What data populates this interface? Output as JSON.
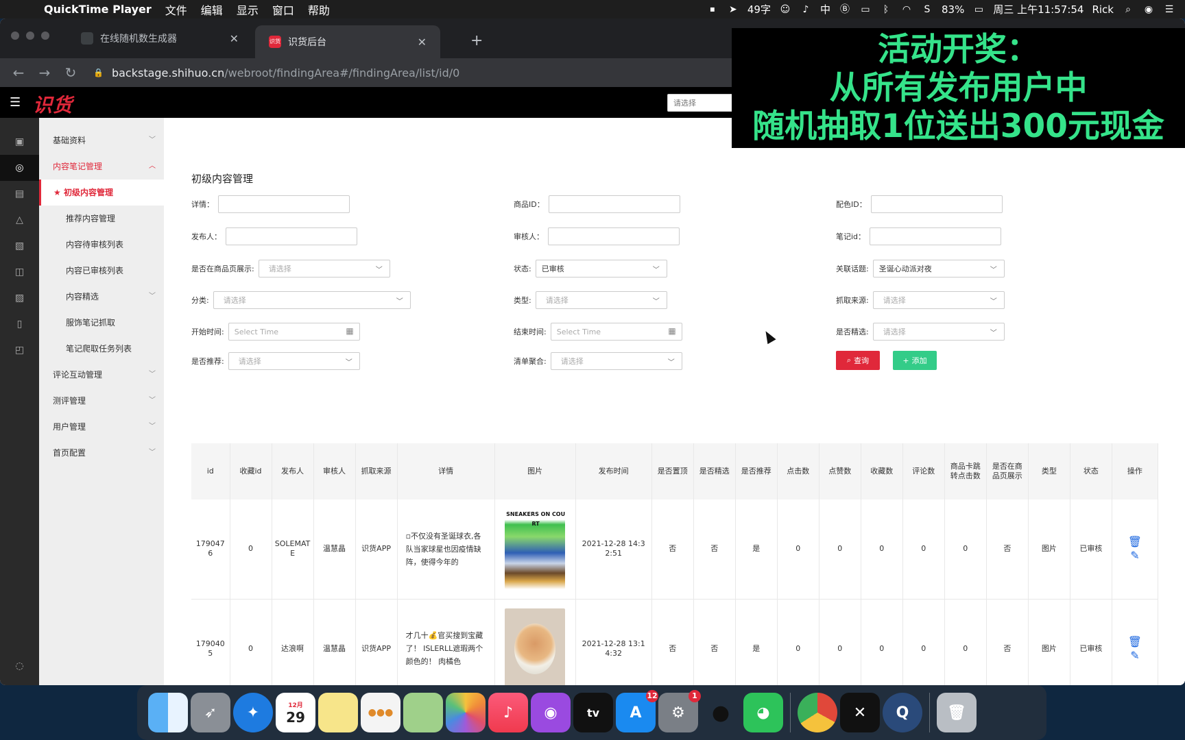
{
  "menubar": {
    "app_name": "QuickTime Player",
    "menus": [
      "文件",
      "编辑",
      "显示",
      "窗口",
      "帮助"
    ],
    "status_text": "49字",
    "input_method": "中",
    "battery": "83%",
    "clock": "周三 上午11:57:54",
    "user": "Rick"
  },
  "browser": {
    "tabs": [
      {
        "title": "在线随机数生成器"
      },
      {
        "title": "识货后台"
      }
    ],
    "url_host": "backstage.shihuo.cn",
    "url_path": "/webroot/findingArea#/findingArea/list/id/0"
  },
  "app": {
    "logo": "识货",
    "search_placeholder": "请选择"
  },
  "banner": {
    "line1": "活动开奖：",
    "line2": "从所有发布用户中",
    "line3": "随机抽取1位送出300元现金"
  },
  "sidebar": {
    "items": [
      {
        "label": "基础资料"
      },
      {
        "label": "内容笔记管理"
      },
      {
        "label": "初级内容管理"
      },
      {
        "label": "推荐内容管理"
      },
      {
        "label": "内容待审核列表"
      },
      {
        "label": "内容已审核列表"
      },
      {
        "label": "内容精选"
      },
      {
        "label": "服饰笔记抓取"
      },
      {
        "label": "笔记爬取任务列表"
      },
      {
        "label": "评论互动管理"
      },
      {
        "label": "测评管理"
      },
      {
        "label": "用户管理"
      },
      {
        "label": "首页配置"
      }
    ]
  },
  "page": {
    "title": "初级内容管理"
  },
  "filters": {
    "detail_label": "详情：",
    "product_id_label": "商品ID：",
    "color_id_label": "配色ID：",
    "publisher_label": "发布人：",
    "reviewer_label": "审核人：",
    "note_id_label": "笔记id：",
    "show_on_product_label": "是否在商品页展示:",
    "show_on_product_value": "请选择",
    "status_label": "状态:",
    "status_value": "已审核",
    "topic_label": "关联话题:",
    "topic_value": "圣诞心动派对夜",
    "category_label": "分类:",
    "category_value": "请选择",
    "type_label": "类型:",
    "type_value": "请选择",
    "source_label": "抓取来源:",
    "source_value": "请选择",
    "start_time_label": "开始时间:",
    "start_time_placeholder": "Select Time",
    "end_time_label": "结束时间:",
    "end_time_placeholder": "Select Time",
    "featured_label": "是否精选:",
    "featured_value": "请选择",
    "recommended_label": "是否推荐:",
    "recommended_value": "请选择",
    "list_agg_label": "清单聚合:",
    "list_agg_value": "请选择",
    "query_button": "查询",
    "add_button": "添加"
  },
  "table": {
    "columns": [
      "id",
      "收藏id",
      "发布人",
      "审核人",
      "抓取来源",
      "详情",
      "图片",
      "发布时间",
      "是否置顶",
      "是否精选",
      "是否推荐",
      "点击数",
      "点赞数",
      "收藏数",
      "评论数",
      "商品卡跳转点击数",
      "是否在商品页展示",
      "类型",
      "状态",
      "操作"
    ],
    "rows": [
      {
        "id": "1790476",
        "fav_id": "0",
        "publisher": "SOLEMATE",
        "reviewer": "温慧晶",
        "source": "识货APP",
        "detail": "▫不仅没有圣诞球衣,各队当家球星也因疫情缺阵，使得今年的",
        "image_text": "SNEAKERS ON COURT",
        "publish_time": "2021-12-28 14:32:51",
        "pinned": "否",
        "featured": "否",
        "recommended": "是",
        "clicks": "0",
        "likes": "0",
        "favorites": "0",
        "comments": "0",
        "card_clicks": "0",
        "show_on_product": "否",
        "type": "图片",
        "status": "已审核"
      },
      {
        "id": "1790405",
        "fav_id": "0",
        "publisher": "达浪啊",
        "reviewer": "温慧晶",
        "source": "识货APP",
        "detail": "才几十💰官买搜到宝藏了！ ISLERLL遮瑕两个颜色的！ 肉橘色",
        "image_text": "",
        "publish_time": "2021-12-28 13:14:32",
        "pinned": "否",
        "featured": "否",
        "recommended": "是",
        "clicks": "0",
        "likes": "0",
        "favorites": "0",
        "comments": "0",
        "card_clicks": "0",
        "show_on_product": "否",
        "type": "图片",
        "status": "已审核"
      }
    ]
  },
  "dock": {
    "calendar_month": "12月",
    "calendar_day": "29",
    "appstore_badge": "12",
    "settings_badge": "1"
  }
}
